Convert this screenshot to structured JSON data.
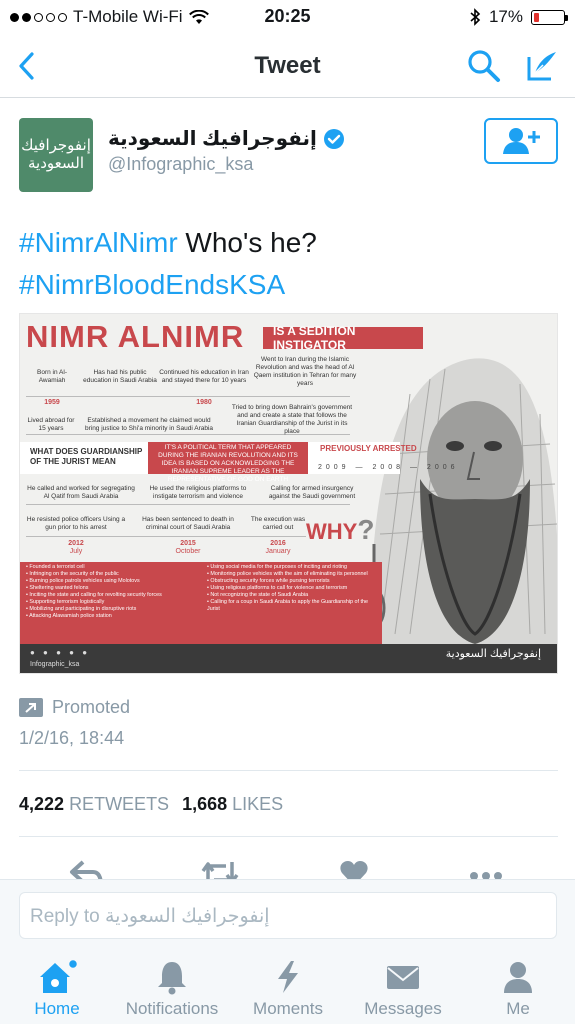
{
  "status_bar": {
    "carrier": "T-Mobile Wi-Fi",
    "time": "20:25",
    "battery": "17%",
    "battery_level": 0.17
  },
  "navbar": {
    "title": "Tweet"
  },
  "tweet": {
    "avatar_text": "إنفوجرافيك السعودية",
    "author_name": "إنفوجرافيك السعودية",
    "author_handle": "@Infographic_ksa",
    "verified": true,
    "text_hashtag_1": "#NimrAlNimr",
    "text_plain": " Who's he?",
    "text_hashtag_2": "#NimrBloodEndsKSA",
    "promoted_label": "Promoted",
    "timestamp": "1/2/16, 18:44",
    "retweets_count": "4,222",
    "retweets_label": "RETWEETS",
    "likes_count": "1,668",
    "likes_label": "LIKES"
  },
  "infographic": {
    "title": "NIMR ALNIMR",
    "banner": "IS A SEDITION INSTIGATOR",
    "row1": [
      {
        "text": "Born in Al-Awamiah",
        "year": "1959"
      },
      {
        "text": "Has had his public education in Saudi Arabia",
        "year": ""
      },
      {
        "text": "Continued his education in Iran and stayed there for 10 years",
        "year": "1980"
      },
      {
        "text": "Went to Iran during the Islamic Revolution and was the head of Al Qaem institution in Tehran for many years",
        "year": ""
      }
    ],
    "row2": [
      {
        "text": "Lived abroad for 15 years"
      },
      {
        "text": "Established a movement he claimed would bring justice to Shi'a minority in Saudi Arabia"
      },
      {
        "text": "Tried to bring down Bahrain's government and and create a state that follows the Iranian Guardianship of the Jurist in its place"
      }
    ],
    "guardianship_label": "WHAT DOES GUARDIANSHIP OF THE JURIST MEAN",
    "guardianship_text": "IT'S A POLITICAL TERM THAT APPEARED DURING THE IRANIAN REVOLUTION AND ITS IDEA IS BASED ON ACKNOWLEDGING THE IRANIAN SUPREME LEADER AS THE REPRESENTATIVE OF GOD ON EARTH",
    "previously_arrested": "PREVIOUSLY ARRESTED",
    "arrest_years": "2009 — 2008 — 2006",
    "row3": [
      {
        "text": "He called and worked for segregating Al Qatif from Saudi Arabia"
      },
      {
        "text": "He used the religious platforms to instigate terrorism and violence"
      },
      {
        "text": "Calling for armed insurgency against the Saudi government"
      }
    ],
    "row4": [
      {
        "text": "He resisted police officers Using a gun prior to his arrest",
        "year": "2012",
        "month": "July"
      },
      {
        "text": "Has been sentenced to death in criminal court of Saudi Arabia",
        "year": "2015",
        "month": "October"
      },
      {
        "text": "The execution was carried out",
        "year": "2016",
        "month": "January"
      }
    ],
    "why": "WHY",
    "list_left": [
      "Founded a terrorist cell",
      "Infringing on the security of the public",
      "Burning police patrols vehicles using Molotovs",
      "Sheltering wanted felons",
      "Inciting the state and calling for revolting security forces",
      "Supporting terrorism logistically",
      "Mobilizing and participating in disruptive riots",
      "Attacking Alawamiah police station"
    ],
    "list_right": [
      "Using social media for the purposes of inciting and rioting",
      "Monitoring police vehicles with the aim of eliminating its personnel",
      "Obstructing security forces while pursing terrorists",
      "Using religious platforms to call for violence and terrorism",
      "Not recognizing the state of Saudi Arabia",
      "Calling for a coup in Saudi Arabia to apply the Guardianship of the Jurist"
    ],
    "footer_handle": "Infographic_ksa",
    "footer_logo": "إنفوجرافيك السعودية"
  },
  "reply_bar": {
    "placeholder": "Reply to إنفوجرافيك السعودية"
  },
  "tabs": [
    {
      "label": "Home",
      "icon": "home-icon",
      "active": true
    },
    {
      "label": "Notifications",
      "icon": "bell-icon",
      "active": false
    },
    {
      "label": "Moments",
      "icon": "lightning-icon",
      "active": false
    },
    {
      "label": "Messages",
      "icon": "envelope-icon",
      "active": false
    },
    {
      "label": "Me",
      "icon": "person-icon",
      "active": false
    }
  ],
  "colors": {
    "accent": "#1da1f2",
    "muted": "#8899a6",
    "infographic_red": "#c8484c"
  }
}
